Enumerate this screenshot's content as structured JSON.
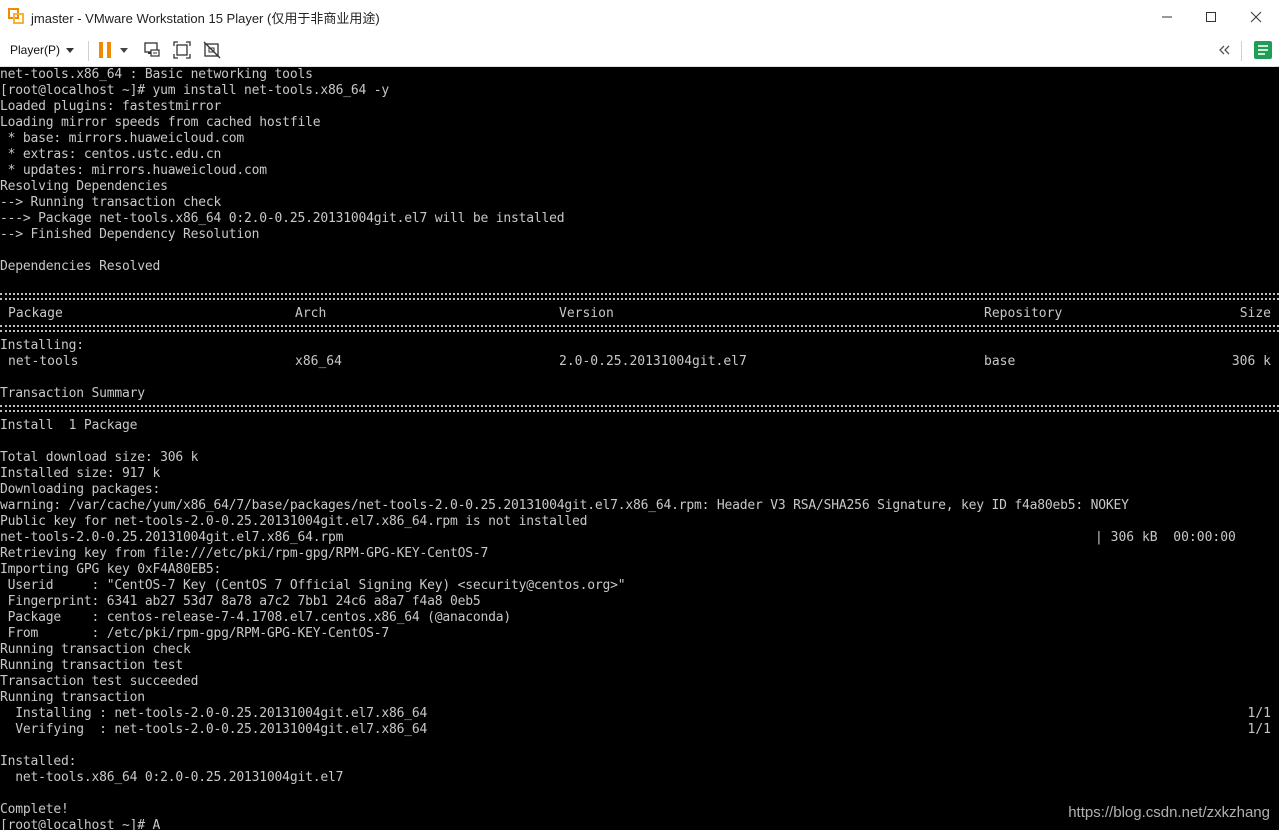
{
  "window": {
    "title": "jmaster - VMware Workstation 15 Player (仅用于非商业用途)",
    "app_icon": "vmware-icon",
    "controls": [
      "minimize-icon",
      "maximize-icon",
      "close-icon"
    ]
  },
  "toolbar": {
    "player_menu_label": "Player(P)",
    "icons": [
      "pause-icon",
      "dropdown-caret-icon",
      "send-ctrl-alt-del-icon",
      "fit-guest-icon",
      "unity-icon",
      "collapse-icon",
      "library-icon"
    ],
    "colors": {
      "pause": "#f08a00",
      "library": "#1f9e55"
    }
  },
  "terminal": {
    "lines_top": [
      "net-tools.x86_64 : Basic networking tools",
      "[root@localhost ~]# yum install net-tools.x86_64 -y",
      "Loaded plugins: fastestmirror",
      "Loading mirror speeds from cached hostfile",
      " * base: mirrors.huaweicloud.com",
      " * extras: centos.ustc.edu.cn",
      " * updates: mirrors.huaweicloud.com",
      "Resolving Dependencies",
      "--> Running transaction check",
      "---> Package net-tools.x86_64 0:2.0-0.25.20131004git.el7 will be installed",
      "--> Finished Dependency Resolution",
      "",
      "Dependencies Resolved"
    ],
    "table": {
      "headers": [
        "Package",
        "Arch",
        "Version",
        "Repository",
        "Size"
      ],
      "group_label": "Installing:",
      "row": [
        "net-tools",
        "x86_64",
        "2.0-0.25.20131004git.el7",
        "base",
        "306 k"
      ]
    },
    "summary_title": "Transaction Summary",
    "summary_line": "Install  1 Package",
    "lines_bottom": [
      "Total download size: 306 k",
      "Installed size: 917 k",
      "Downloading packages:",
      "warning: /var/cache/yum/x86_64/7/base/packages/net-tools-2.0-0.25.20131004git.el7.x86_64.rpm: Header V3 RSA/SHA256 Signature, key ID f4a80eb5: NOKEY",
      "Public key for net-tools-2.0-0.25.20131004git.el7.x86_64.rpm is not installed"
    ],
    "download_line": {
      "file": "net-tools-2.0-0.25.20131004git.el7.x86_64.rpm",
      "stats": "| 306 kB  00:00:00"
    },
    "lines_gpg": [
      "Retrieving key from file:///etc/pki/rpm-gpg/RPM-GPG-KEY-CentOS-7",
      "Importing GPG key 0xF4A80EB5:",
      " Userid     : \"CentOS-7 Key (CentOS 7 Official Signing Key) <security@centos.org>\"",
      " Fingerprint: 6341 ab27 53d7 8a78 a7c2 7bb1 24c6 a8a7 f4a8 0eb5",
      " Package    : centos-release-7-4.1708.el7.centos.x86_64 (@anaconda)",
      " From       : /etc/pki/rpm-gpg/RPM-GPG-KEY-CentOS-7",
      "Running transaction check",
      "Running transaction test",
      "Transaction test succeeded",
      "Running transaction"
    ],
    "progress_lines": [
      {
        "text": "  Installing : net-tools-2.0-0.25.20131004git.el7.x86_64",
        "count": "1/1"
      },
      {
        "text": "  Verifying  : net-tools-2.0-0.25.20131004git.el7.x86_64",
        "count": "1/1"
      }
    ],
    "installed_label": "Installed:",
    "installed_item": "  net-tools.x86_64 0:2.0-0.25.20131004git.el7",
    "complete": "Complete!",
    "prompt": "[root@localhost ~]# ",
    "cursor_char": "A"
  },
  "watermark": "https://blog.csdn.net/zxkzhang"
}
